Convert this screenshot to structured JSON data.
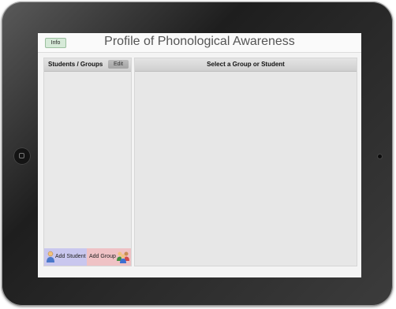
{
  "app": {
    "title": "Profile of Phonological Awareness",
    "info_label": "Info"
  },
  "left_panel": {
    "title": "Students / Groups",
    "edit_label": "Edit",
    "add_student_label": "Add Student",
    "add_group_label": "Add Group"
  },
  "main_panel": {
    "title": "Select a Group or Student"
  },
  "icons": {
    "student": "student-icon",
    "group": "group-icon"
  },
  "colors": {
    "add_student_bg": "#c9c7ee",
    "add_group_bg": "#efc2c5",
    "info_bg": "#d6ead8"
  }
}
